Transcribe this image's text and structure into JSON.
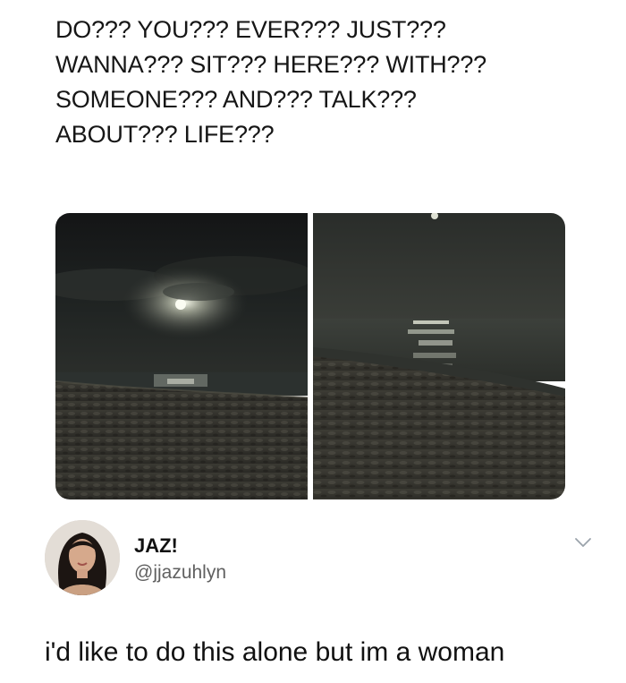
{
  "caption": {
    "lines": [
      "DO??? YOU??? EVER??? JUST???",
      "WANNA??? SIT??? HERE??? WITH???",
      "SOMEONE??? AND??? TALK???",
      "ABOUT??? LIFE???"
    ]
  },
  "photos": [
    {
      "icon": "beach-moon-photo-left"
    },
    {
      "icon": "beach-moon-photo-right"
    }
  ],
  "author": {
    "display_name": "JAZ!",
    "handle": "@jjazuhlyn"
  },
  "menu": {
    "icon": "chevron-down-icon"
  },
  "tweet": {
    "text": "i'd like to do this alone but im a woman"
  },
  "colors": {
    "background": "#ffffff",
    "text": "#111111",
    "handle": "#606060",
    "chevron": "#9aa3ab"
  }
}
